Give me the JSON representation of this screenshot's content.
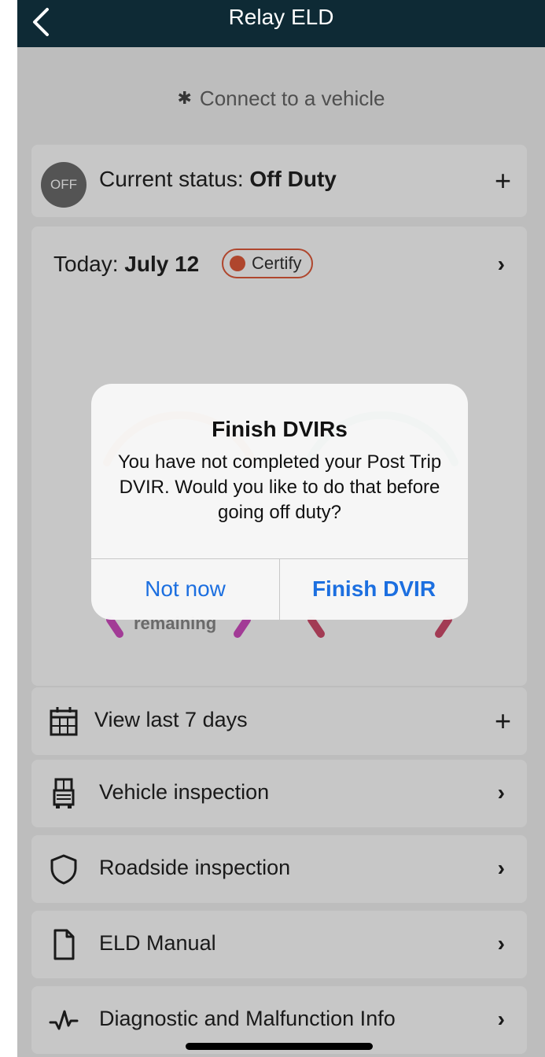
{
  "header": {
    "title": "Relay ELD"
  },
  "connect": {
    "label": "Connect to a vehicle"
  },
  "status": {
    "badge": "OFF",
    "prefix": "Current status: ",
    "value": "Off Duty"
  },
  "today": {
    "prefix": "Today: ",
    "date": "July 12",
    "certify_label": "Certify",
    "gauge_left_caption": "remaining"
  },
  "menu": {
    "items": [
      {
        "label": "View last 7 days",
        "icon": "calendar-icon"
      },
      {
        "label": "Vehicle inspection",
        "icon": "truck-icon"
      },
      {
        "label": "Roadside inspection",
        "icon": "shield-icon"
      },
      {
        "label": "ELD Manual",
        "icon": "document-icon"
      },
      {
        "label": "Diagnostic and Malfunction Info",
        "icon": "pulse-icon"
      }
    ]
  },
  "modal": {
    "title": "Finish DVIRs",
    "message": "You have not completed your Post Trip DVIR. Would you like to do that before going off duty?",
    "cancel_label": "Not now",
    "confirm_label": "Finish DVIR"
  },
  "colors": {
    "header_bg": "#0e2a35",
    "accent_blue": "#1c6fe0",
    "certify_red": "#e05a3a",
    "gauge_orange": "#e08a2c",
    "gauge_teal": "#2a9d8a",
    "gauge_pink": "#d04cc0"
  }
}
